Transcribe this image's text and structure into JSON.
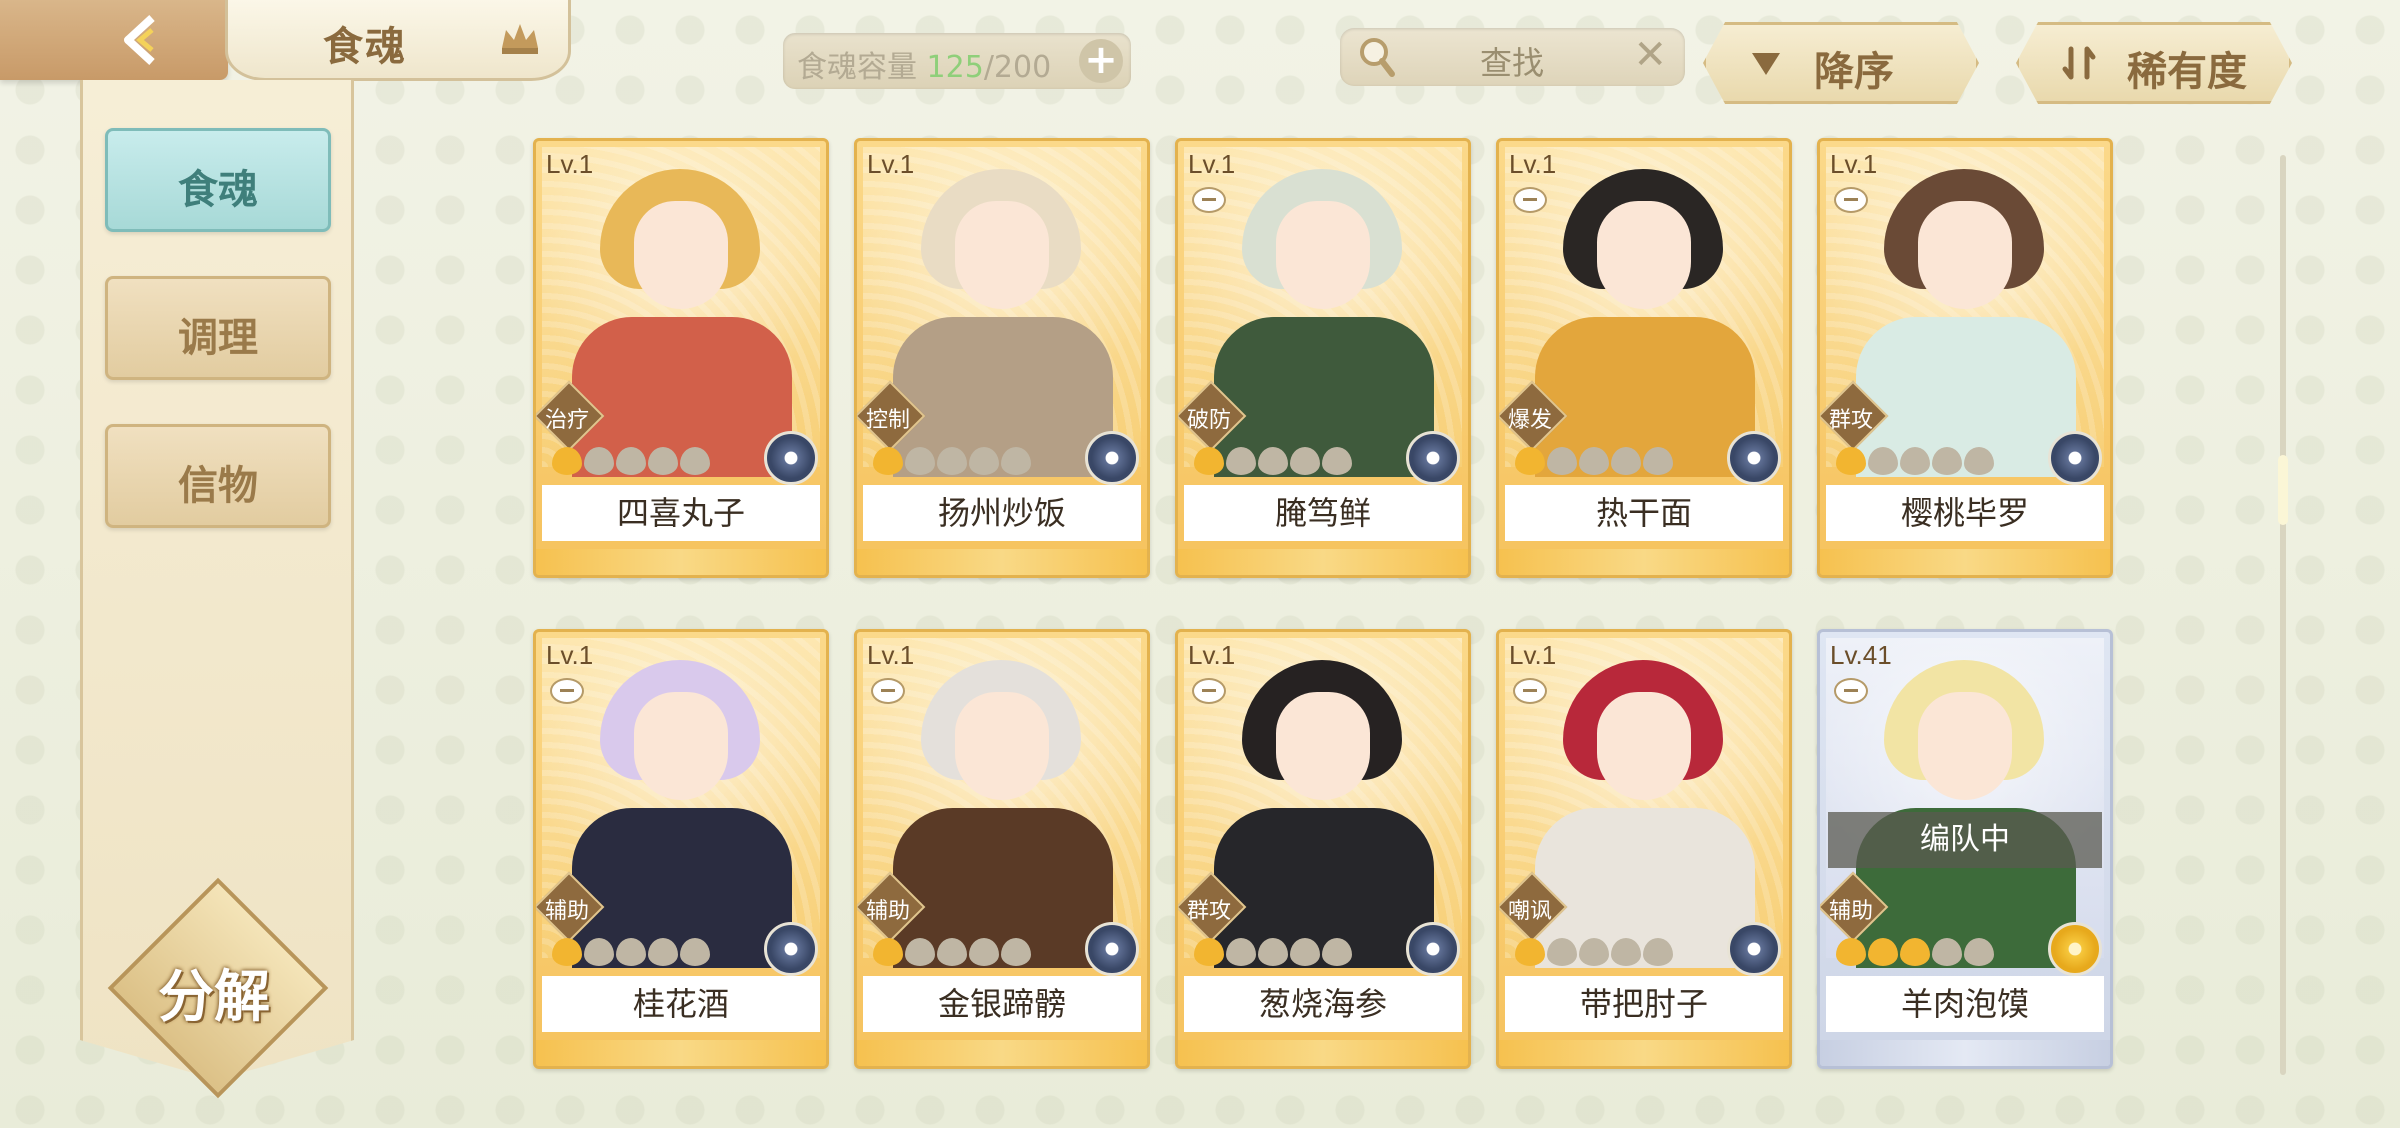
{
  "header": {
    "page_title": "食魂",
    "capacity_label": "食魂容量",
    "capacity_current": "125",
    "capacity_max": "/200",
    "add_label": "+",
    "search_placeholder": "查找",
    "clear_label": "✕",
    "sort_label": "降序",
    "rarity_label": "稀有度"
  },
  "sidebar": {
    "tabs": [
      {
        "label": "食魂",
        "active": true
      },
      {
        "label": "调理",
        "active": false
      },
      {
        "label": "信物",
        "active": false
      }
    ],
    "decompose_label": "分解"
  },
  "cards": [
    {
      "level": "Lv.1",
      "name": "四喜丸子",
      "role": "治疗",
      "stars_on": 1,
      "stars_total": 5,
      "hair": "#e8b858",
      "body": "#d2604a"
    },
    {
      "level": "Lv.1",
      "name": "扬州炒饭",
      "role": "控制",
      "stars_on": 1,
      "stars_total": 5,
      "hair": "#e9dcc4",
      "body": "#b49f86"
    },
    {
      "level": "Lv.1",
      "name": "腌笃鲜",
      "role": "破防",
      "stars_on": 1,
      "stars_total": 5,
      "hair": "#d9e0d2",
      "body": "#3f5a3c"
    },
    {
      "level": "Lv.1",
      "name": "热干面",
      "role": "爆发",
      "stars_on": 1,
      "stars_total": 5,
      "hair": "#2a2624",
      "body": "#e3a63c"
    },
    {
      "level": "Lv.1",
      "name": "樱桃毕罗",
      "role": "群攻",
      "stars_on": 1,
      "stars_total": 5,
      "hair": "#6a4a36",
      "body": "#d9ebe4"
    },
    {
      "level": "Lv.1",
      "name": "桂花酒",
      "role": "辅助",
      "stars_on": 1,
      "stars_total": 5,
      "hair": "#d9c9ec",
      "body": "#2a2c40"
    },
    {
      "level": "Lv.1",
      "name": "金银蹄髈",
      "role": "辅助",
      "stars_on": 1,
      "stars_total": 5,
      "hair": "#e4e0db",
      "body": "#5a3a26"
    },
    {
      "level": "Lv.1",
      "name": "葱烧海参",
      "role": "群攻",
      "stars_on": 1,
      "stars_total": 5,
      "hair": "#262222",
      "body": "#26262a"
    },
    {
      "level": "Lv.1",
      "name": "带把肘子",
      "role": "嘲讽",
      "stars_on": 1,
      "stars_total": 5,
      "hair": "#b8283a",
      "body": "#e9e4dc"
    },
    {
      "level": "Lv.41",
      "name": "羊肉泡馍",
      "role": "辅助",
      "stars_on": 3,
      "stars_total": 5,
      "hair": "#f2e4a4",
      "body": "#3d6b3a",
      "in_team": true,
      "team_label": "编队中"
    }
  ],
  "colors": {
    "accent_teal": "#a7d9d7",
    "gold": "#f6c25d",
    "star_on": "#f2b530",
    "capacity_green": "#8fcf7a"
  },
  "icons": [
    "back-arrow-icon",
    "crown-icon",
    "plus-icon",
    "search-icon",
    "clear-icon",
    "sort-desc-icon",
    "rarity-icon",
    "flower-icon",
    "role-badge-icon",
    "minus-icon"
  ]
}
